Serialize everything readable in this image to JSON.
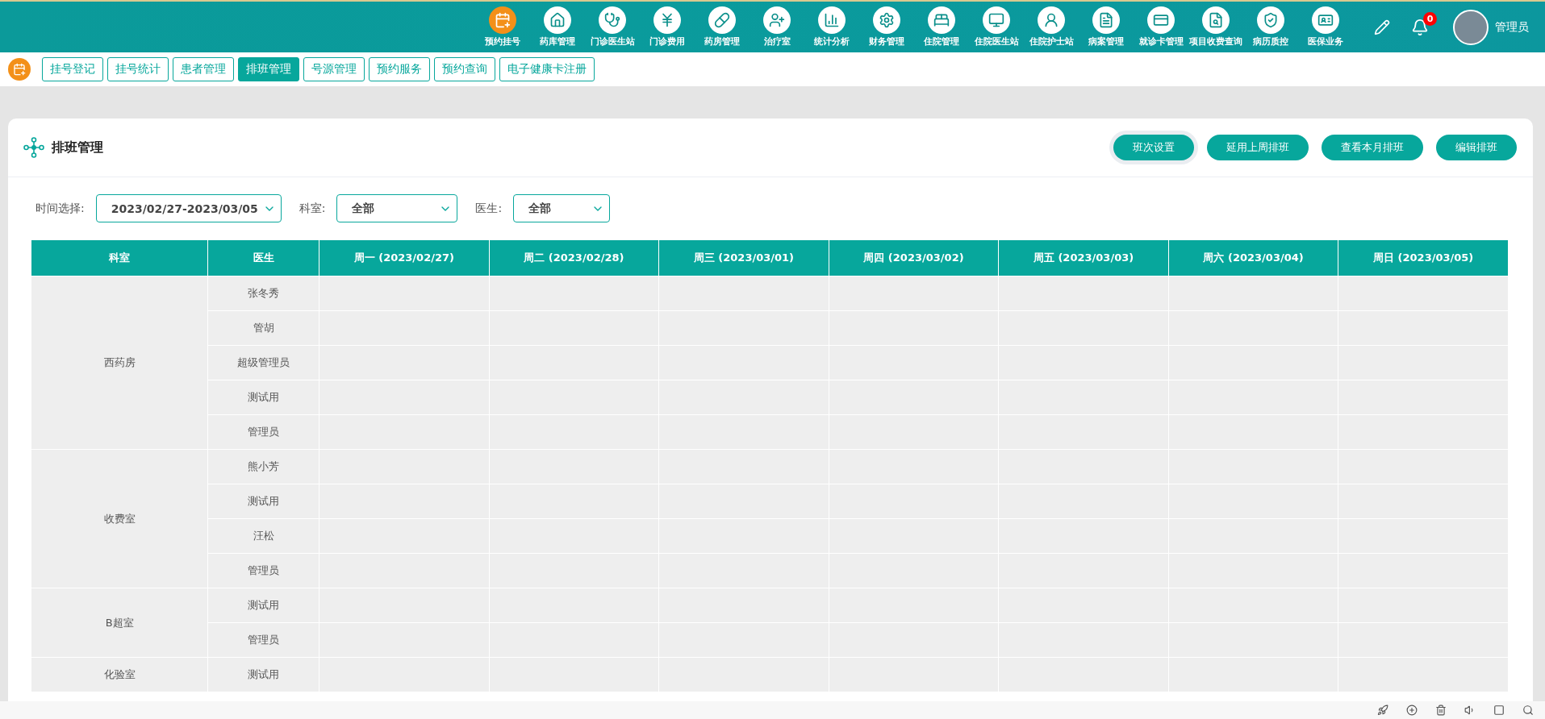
{
  "top_nav": {
    "items": [
      {
        "label": "预约挂号",
        "selected": true
      },
      {
        "label": "药库管理",
        "selected": false
      },
      {
        "label": "门诊医生站",
        "selected": false
      },
      {
        "label": "门诊费用",
        "selected": false
      },
      {
        "label": "药房管理",
        "selected": false
      },
      {
        "label": "治疗室",
        "selected": false
      },
      {
        "label": "统计分析",
        "selected": false
      },
      {
        "label": "财务管理",
        "selected": false
      },
      {
        "label": "住院管理",
        "selected": false
      },
      {
        "label": "住院医生站",
        "selected": false
      },
      {
        "label": "住院护士站",
        "selected": false
      },
      {
        "label": "病案管理",
        "selected": false
      },
      {
        "label": "就诊卡管理",
        "selected": false
      },
      {
        "label": "项目收费查询",
        "selected": false
      },
      {
        "label": "病历质控",
        "selected": false
      },
      {
        "label": "医保业务",
        "selected": false
      }
    ],
    "notification_count": "0",
    "user": "管理员"
  },
  "tabs": [
    {
      "label": "挂号登记",
      "selected": false
    },
    {
      "label": "挂号统计",
      "selected": false
    },
    {
      "label": "患者管理",
      "selected": false
    },
    {
      "label": "排班管理",
      "selected": true
    },
    {
      "label": "号源管理",
      "selected": false
    },
    {
      "label": "预约服务",
      "selected": false
    },
    {
      "label": "预约查询",
      "selected": false
    },
    {
      "label": "电子健康卡注册",
      "selected": false
    }
  ],
  "card": {
    "title": "排班管理",
    "buttons": [
      {
        "label": "班次设置",
        "focused": true
      },
      {
        "label": "延用上周排班",
        "focused": false
      },
      {
        "label": "查看本月排班",
        "focused": false
      },
      {
        "label": "编辑排班",
        "focused": false
      }
    ],
    "filters": [
      {
        "label": "时间选择:",
        "value": "2023/02/27-2023/03/05"
      },
      {
        "label": "科室:",
        "value": "全部"
      },
      {
        "label": "医生:",
        "value": "全部"
      }
    ],
    "table": {
      "columns": [
        "科室",
        "医生",
        "周一 (2023/02/27)",
        "周二 (2023/02/28)",
        "周三 (2023/03/01)",
        "周四 (2023/03/02)",
        "周五 (2023/03/03)",
        "周六 (2023/03/04)",
        "周日 (2023/03/05)"
      ],
      "groups": [
        {
          "department": "西药房",
          "doctors": [
            "张冬秀",
            "管胡",
            "超级管理员",
            "测试用",
            "管理员"
          ]
        },
        {
          "department": "收费室",
          "doctors": [
            "熊小芳",
            "测试用",
            "汪松",
            "管理员"
          ]
        },
        {
          "department": "B超室",
          "doctors": [
            "测试用",
            "管理员"
          ]
        },
        {
          "department": "化验室",
          "doctors": [
            "测试用"
          ]
        }
      ]
    }
  }
}
